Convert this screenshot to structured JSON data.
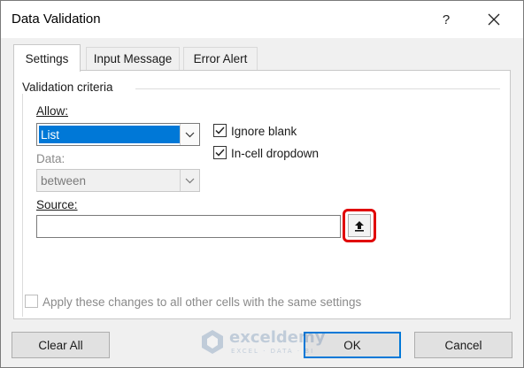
{
  "window": {
    "title": "Data Validation",
    "help_label": "?",
    "close_icon": "close-icon"
  },
  "tabs": [
    {
      "label": "Settings",
      "active": true
    },
    {
      "label": "Input Message",
      "active": false
    },
    {
      "label": "Error Alert",
      "active": false
    }
  ],
  "settings": {
    "group_label": "Validation criteria",
    "allow_label": "Allow:",
    "allow_value": "List",
    "data_label": "Data:",
    "data_value": "between",
    "ignore_blank": {
      "label": "Ignore blank",
      "checked": true
    },
    "in_cell_dropdown": {
      "label": "In-cell dropdown",
      "checked": true
    },
    "source_label": "Source:",
    "source_value": "",
    "collapse_icon": "collapse-dialog-icon",
    "apply_all": {
      "label": "Apply these changes to all other cells with the same settings",
      "checked": false,
      "enabled": false
    }
  },
  "buttons": {
    "clear_all": "Clear All",
    "ok": "OK",
    "cancel": "Cancel"
  },
  "watermark": {
    "name": "exceldemy",
    "tagline": "EXCEL · DATA · BI"
  },
  "colors": {
    "selection": "#0078d7",
    "highlight_border": "#e00000",
    "default_button_border": "#0078d7"
  }
}
